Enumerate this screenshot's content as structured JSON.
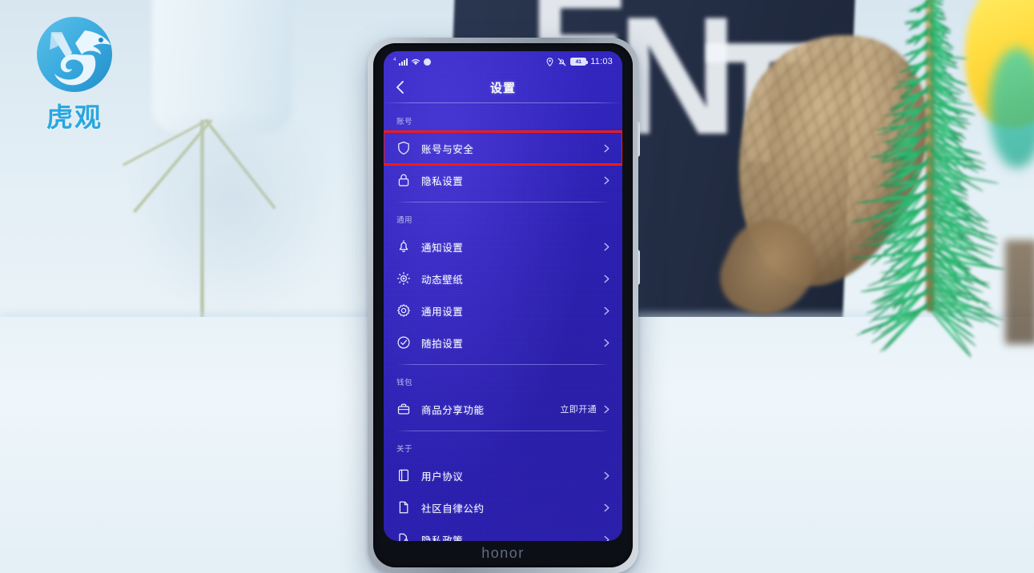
{
  "watermark": {
    "text": "虎观",
    "logo_icon": "tiger-swirl-logo-icon",
    "color": "#2aa7e0"
  },
  "device": {
    "brand": "honor",
    "screen_bg_color": "#2b20b5",
    "highlight_color": "#f51b12"
  },
  "status_bar": {
    "network_label": "4",
    "signal_icon": "signal-bars-icon",
    "wifi_icon": "wifi-icon",
    "dot_icon": "dot-indicator-icon",
    "location_icon": "location-pin-icon",
    "mute_icon": "mute-bell-icon",
    "battery_level": "41",
    "battery_icon": "battery-icon",
    "time": "11:03"
  },
  "app_bar": {
    "back_icon": "back-chevron-icon",
    "title": "设置"
  },
  "sections": [
    {
      "label": "账号",
      "items": [
        {
          "icon": "shield-icon",
          "label": "账号与安全",
          "value": "",
          "highlighted": true
        },
        {
          "icon": "lock-icon",
          "label": "隐私设置",
          "value": "",
          "highlighted": false
        }
      ]
    },
    {
      "label": "通用",
      "items": [
        {
          "icon": "bell-icon",
          "label": "通知设置",
          "value": "",
          "highlighted": false
        },
        {
          "icon": "dynamic-wallpaper-icon",
          "label": "动态壁纸",
          "value": "",
          "highlighted": false
        },
        {
          "icon": "gear-icon",
          "label": "通用设置",
          "value": "",
          "highlighted": false
        },
        {
          "icon": "check-circle-icon",
          "label": "随拍设置",
          "value": "",
          "highlighted": false
        }
      ]
    },
    {
      "label": "钱包",
      "items": [
        {
          "icon": "briefcase-icon",
          "label": "商品分享功能",
          "value": "立即开通",
          "highlighted": false
        }
      ]
    },
    {
      "label": "关于",
      "items": [
        {
          "icon": "book-icon",
          "label": "用户协议",
          "value": "",
          "highlighted": false
        },
        {
          "icon": "document-icon",
          "label": "社区自律公约",
          "value": "",
          "highlighted": false
        },
        {
          "icon": "document-lock-icon",
          "label": "隐私政策",
          "value": "",
          "highlighted": false
        }
      ]
    }
  ],
  "background": {
    "box_letters": "ENT",
    "objects": [
      "lamp",
      "navy-box",
      "pine-cone",
      "pine-branch"
    ]
  }
}
